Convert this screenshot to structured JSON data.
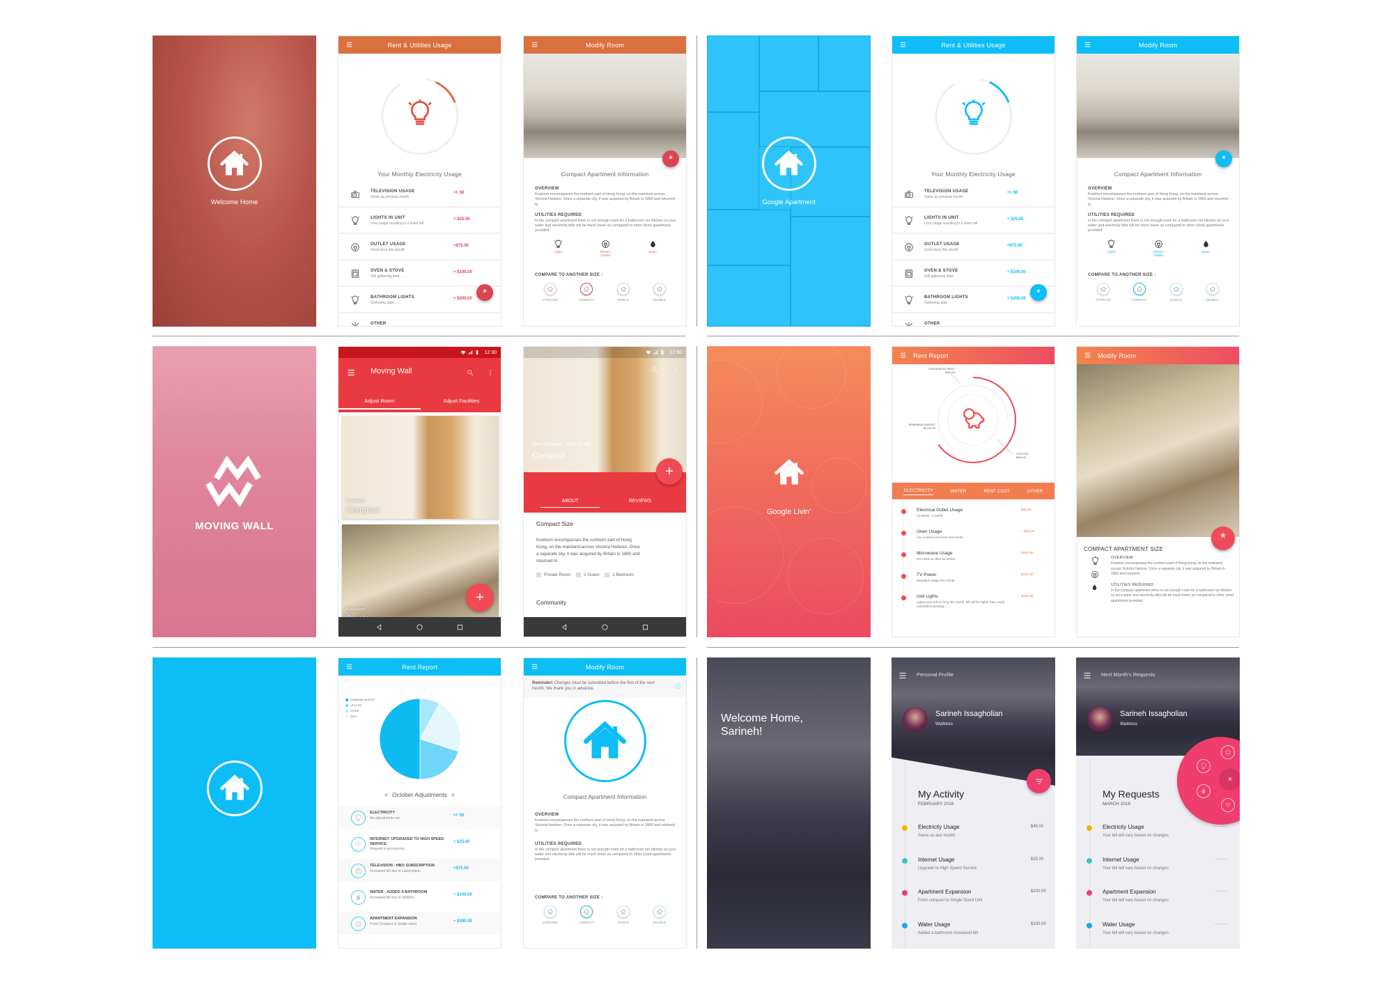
{
  "colors": {
    "orange": "#d9703e",
    "blue": "#0dbdf6",
    "red": "#e9393f",
    "coral": "#f27d50",
    "pink": "#ef3d6e"
  },
  "screens": [
    {
      "type": "splash",
      "theme": "photo-orange",
      "logo": "house-icon",
      "title": "Welcome Home"
    },
    {
      "type": "usage",
      "accent": "#d9703e",
      "fab_accent": "#dc4452",
      "header": "Rent & Utilities Usage",
      "gauge_fraction": 0.12,
      "gauge_title": "Your Monthly Electricity Usage",
      "rows": [
        {
          "icon": "tv-icon",
          "title": "TELEVISION USAGE",
          "sub": "Same as previous month.",
          "value": "+/- $0"
        },
        {
          "icon": "bulb-icon",
          "title": "LIGHTS IN UNIT",
          "sub": "Less usage resulting in a lower bill",
          "value": "+ $25.00"
        },
        {
          "icon": "outlet-icon",
          "title": "OUTLET USAGE",
          "sub": "Used more this month",
          "value": "+$75.00"
        },
        {
          "icon": "oven-icon",
          "title": "OVEN & STOVE",
          "sub": "Still gathering data . . .",
          "value": "+ $100.00"
        },
        {
          "icon": "bulb-icon",
          "title": "BATHROOM LIGHTS",
          "sub": "Gathering data . . .",
          "value": "+ $200.00"
        },
        {
          "icon": "other-icon",
          "title": "OTHER",
          "sub": "",
          "value": ""
        }
      ],
      "fab_icon": "asterisk-icon"
    },
    {
      "type": "modify",
      "accent": "#d9703e",
      "fab_accent": "#dc4452",
      "header": "Modify Room",
      "title": "Compact Apartment Information",
      "overview_label": "OVERVIEW",
      "overview": "Kowloon encompasses the northern part of Hong Kong, on the mainland across Victoria Harbour. Once a separate city, it was acquired by Britain in 1860 and returned to",
      "utilities_label": "UTILITIES REQUIRED",
      "utilities": "In the compact apartment there is not enough room for a bathroom nor kitchen so your water and electricity bills will be much lower as compared to other sized apartments provided.",
      "features": [
        {
          "icon": "bulb-icon",
          "label": "Lights"
        },
        {
          "icon": "outlet-icon",
          "label": "Electric Outlets"
        },
        {
          "icon": "drop-icon",
          "label": "Water"
        }
      ],
      "compare_label": "COMPARE TO ANOTHER SIZE :",
      "sizes": [
        "STORAGE",
        "COMPACT",
        "SINGLE",
        "DOUBLE"
      ],
      "selected_size": "COMPACT"
    },
    {
      "type": "splash",
      "theme": "blue-tiles",
      "logo": "house-icon",
      "title": "Google Apartment"
    },
    {
      "type": "usage",
      "accent": "#0dbdf6",
      "fab_accent": "#0dbdf6",
      "header": "Rent & Utilities Usage",
      "gauge_fraction": 0.12,
      "gauge_title": "Your Monthly Electricity Usage",
      "rows": [
        {
          "icon": "tv-icon",
          "title": "TELEVISION USAGE",
          "sub": "Same as previous month.",
          "value": "+/- $0"
        },
        {
          "icon": "bulb-icon",
          "title": "LIGHTS IN UNIT",
          "sub": "Less usage resulting in a lower bill",
          "value": "+ $25.00"
        },
        {
          "icon": "outlet-icon",
          "title": "OUTLET USAGE",
          "sub": "Used more this month",
          "value": "+$75.00"
        },
        {
          "icon": "oven-icon",
          "title": "OVEN & STOVE",
          "sub": "Still gathering data . . .",
          "value": "+ $100.00"
        },
        {
          "icon": "bulb-icon",
          "title": "BATHROOM LIGHTS",
          "sub": "Gathering data . . .",
          "value": "+ $200.00"
        },
        {
          "icon": "other-icon",
          "title": "OTHER",
          "sub": "",
          "value": ""
        }
      ],
      "fab_icon": "asterisk-icon"
    },
    {
      "type": "modify",
      "accent": "#0dbdf6",
      "fab_accent": "#0dbdf6",
      "header": "Modify Room",
      "title": "Compact Apartment Information",
      "overview_label": "OVERVIEW",
      "overview": "Kowloon encompasses the northern part of Hong Kong, on the mainland across Victoria Harbour. Once a separate city, it was acquired by Britain in 1860 and returned to",
      "utilities_label": "UTILITIES REQUIRED",
      "utilities": "In the compact apartment there is not enough room for a bathroom nor kitchen so your water and electricity bills will be much lower as compared to other sized apartments provided.",
      "features": [
        {
          "icon": "bulb-icon",
          "label": "Lights"
        },
        {
          "icon": "outlet-icon",
          "label": "Electric Outlets"
        },
        {
          "icon": "drop-icon",
          "label": "Water"
        }
      ],
      "compare_label": "COMPARE TO ANOTHER SIZE :",
      "sizes": [
        "STORAGE",
        "COMPACT",
        "SINGLE",
        "DOUBLE"
      ],
      "selected_size": "COMPACT"
    },
    {
      "type": "splash",
      "theme": "pink-photo",
      "logo": "mw-logo",
      "title": "MOVING WALL"
    },
    {
      "type": "mw-list",
      "status_time": "12:30",
      "title": "Moving Wall",
      "tabs": [
        "Adjust Room",
        "Adjust Facilities"
      ],
      "active_tab": "Adjust Room",
      "cards": [
        {
          "location": "Kowloon",
          "name": "Compact"
        },
        {
          "location": "Kowloon",
          "name": "Single"
        }
      ]
    },
    {
      "type": "mw-detail",
      "status_time": "12:30",
      "location": "West Kowloon, Zone 1, HK",
      "name": "Compact",
      "tabs": [
        "ABOUT",
        "REVIEWS"
      ],
      "active_tab": "ABOUT",
      "section": "Compact Size",
      "body": "Kowloon encompasses the northern part of Hong Kong, on the mainland across Victoria Harbour. Once a separate city, it was acquired by Britain in 1860 and returned to",
      "amenities": [
        "Private Room",
        "1 Guest",
        "1 Bedroom"
      ],
      "section2": "Community"
    },
    {
      "type": "splash",
      "theme": "orange-gradient",
      "logo": "house-icon",
      "title": "Google Livin'"
    },
    {
      "type": "rent-radial",
      "header": "Rent Report",
      "labels": {
        "rent": "THIS MONTH'S RENT",
        "rent_value": "$300.00",
        "budget": "REMAINING BUDGET",
        "budget_value": "$2,000.00",
        "utilities": "UTILITIES",
        "utilities_value": "$400.00"
      },
      "tabs": [
        "ELECTRICITY",
        "WATER",
        "RENT COST",
        "OTHER"
      ],
      "active_tab": "ELECTRICITY",
      "rows": [
        {
          "title": "Electrical Outlet Usage",
          "sub": "12:00PM - 4:30PM",
          "value": "$45.00"
        },
        {
          "title": "Oven Usage",
          "sub": "You cooked a lot more this month",
          "value": "+ $25.00"
        },
        {
          "title": "Microwave Usage",
          "sub": "Not used as often as before",
          "value": "$200.00"
        },
        {
          "title": "TV Power",
          "sub": "Standard Usage this month",
          "value": "$100.00"
        },
        {
          "title": "Unit Lights",
          "sub": "Lights were left on long this month, bill will be higher than usual. Calculation pending . . . .",
          "value": "$100.00"
        }
      ]
    },
    {
      "type": "bedroom",
      "header": "Modify Room",
      "title": "COMPACT APARTMENT SIZE",
      "overview_label": "OVERVIEW",
      "overview": "Kowloon encompasses the northern part of Hong Kong, on the mainland across Victoria Harbour. Once a separate city, it was acquired by Britain in 1860 and returned.",
      "utilities_label": "UTILITIES REQUIRED",
      "utilities": "In the compact apartment there is not enough room for a bathroom nor kitchen so your water and electricity bills will be much lower as compared to other sized apartments provided."
    },
    {
      "type": "splash",
      "theme": "blue-plain",
      "logo": "house-icon",
      "title": ""
    },
    {
      "type": "pie",
      "header": "Rent Report",
      "legend": [
        {
          "label": "REMAINING BUDGET",
          "color": "#0dbaf2",
          "value": 0.5
        },
        {
          "label": "UTILITIES",
          "color": "#6fd6f9",
          "value": 0.2
        },
        {
          "label": "OTHER",
          "color": "#a9e7fc",
          "value": 0.08
        },
        {
          "label": "RENT",
          "color": "#e4f7fd",
          "value": 0.22
        }
      ],
      "month_label": "October Adjustments",
      "prev": "<",
      "next": ">",
      "rows": [
        {
          "icon": "bulb-icon",
          "title": "ELECTRICITY",
          "sub": "No adjustments set",
          "value": "+/- $0"
        },
        {
          "icon": "wifi-icon",
          "title": "INTERNET: UPGRADED TO HIGH SPEED SERVICE",
          "sub": "Request is processing...",
          "value": "+ $25.00"
        },
        {
          "icon": "tv-icon",
          "title": "TELEVISION : HBO SUBSCRIPTION",
          "sub": "Increased bill due to subscription",
          "value": "+$75.00"
        },
        {
          "icon": "drop-icon",
          "title": "WATER : ADDED A BATHROOM",
          "sub": "Increased bill due to addition",
          "value": "+ $100.00"
        },
        {
          "icon": "house-icon",
          "title": "APARTMENT EXPANSION",
          "sub": "From Compact to Single sized",
          "value": "+ $200.00"
        }
      ]
    },
    {
      "type": "modify-reminder",
      "accent": "#0dbdf6",
      "header": "Modify Room",
      "reminder_bold": "Reminder!",
      "reminder": "Changes must be submitted before the first of the next month. We thank you in advance.",
      "title": "Compact Apartment Information",
      "overview_label": "OVERVIEW",
      "overview": "Kowloon encompasses the northern part of Hong Kong, on the mainland across Victoria Harbour. Once a separate city, it was acquired by Britain in 1860 and returned to",
      "utilities_label": "UTILITIES REQUIRED",
      "utilities": "In the compact apartment there is not enough room for a bathroom nor kitchen so your water and electricity bills will be much lower as compared to other sized apartments provided.",
      "compare_label": "COMPARE TO ANOTHER SIZE :",
      "sizes": [
        "STORAGE",
        "COMPACT",
        "SINGLE",
        "DOUBLE"
      ],
      "selected_size": "COMPACT"
    },
    {
      "type": "splash",
      "theme": "city",
      "logo": "",
      "title": "Welcome Home, Sarineh!"
    },
    {
      "type": "profile",
      "variant": "activity",
      "header": "Personal Profile",
      "name": "Sarineh Issagholian",
      "role": "Waitress",
      "title": "My Activity",
      "date": "FEBRUARY 2016",
      "items": [
        {
          "title": "Electricity Usage",
          "sub": "Same as last month",
          "value": "$45.00",
          "color": "#f5b400"
        },
        {
          "title": "Internet Usage",
          "sub": "Upgrade to High Speed Service",
          "value": "$25.00",
          "color": "#3cc7b5"
        },
        {
          "title": "Apartment Expansion",
          "sub": "From compact to Single Sized Unit",
          "value": "$200.00",
          "color": "#ee3d6b"
        },
        {
          "title": "Water Usage",
          "sub": "Added a bathroom increased bill",
          "value": "$100.00",
          "color": "#1aa7f0"
        }
      ]
    },
    {
      "type": "profile",
      "variant": "requests",
      "header": "Next Month's Requests",
      "name": "Sarineh Issagholian",
      "role": "Waitress",
      "title": "My Requests",
      "date": "MARCH 2016",
      "items": [
        {
          "title": "Electricity Usage",
          "sub": "Your bill will vary based on changes",
          "value": "- - - - -",
          "color": "#f5b400"
        },
        {
          "title": "Internet Usage",
          "sub": "Your bill will vary based on changes",
          "value": "- - - - -",
          "color": "#3cc7b5"
        },
        {
          "title": "Apartment Expansion",
          "sub": "Your bill will vary based on changes",
          "value": "- - - - -",
          "color": "#ee3d6b"
        },
        {
          "title": "Water Usage",
          "sub": "Your bill will vary based on changes",
          "value": "- - - - -",
          "color": "#1aa7f0"
        }
      ]
    }
  ]
}
